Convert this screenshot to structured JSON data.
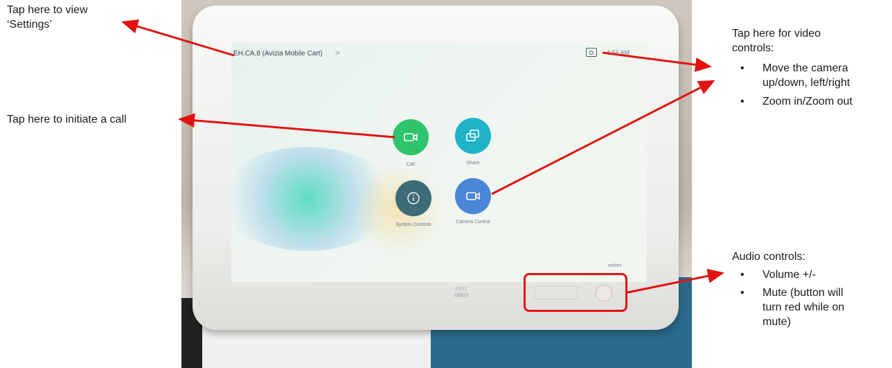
{
  "annotations": {
    "settings": {
      "line1": "Tap here to view",
      "line2": "‘Settings’"
    },
    "call": "Tap here to initiate a call",
    "video": {
      "line1": "Tap here for video",
      "line2": "controls:",
      "bullets": [
        {
          "line1": "Move the camera",
          "line2": "up/down, left/right"
        },
        {
          "line1": "Zoom in/Zoom out",
          "line2": ""
        }
      ]
    },
    "audio": {
      "heading": "Audio controls:",
      "bullets": [
        {
          "line1": "Volume +/-",
          "lines": []
        },
        {
          "line1": "Mute (button will",
          "lines": [
            "turn red while on",
            "mute)"
          ]
        }
      ]
    }
  },
  "screen": {
    "title": "EH.CA.8 (Avizia Mobile Cart)",
    "chevron": ">",
    "time": "4:56 AM",
    "buttons": {
      "call": {
        "label": "Call",
        "color": "#2ec46b"
      },
      "share": {
        "label": "Share",
        "color": "#1fb3c9"
      },
      "system": {
        "label": "System Controls",
        "color": "#3d6b78"
      },
      "camera": {
        "label": "Camera Control",
        "color": "#4a86d8"
      }
    },
    "brand": "webex"
  },
  "device": {
    "logo": "cisco"
  },
  "colors": {
    "arrow": "#e31212"
  }
}
